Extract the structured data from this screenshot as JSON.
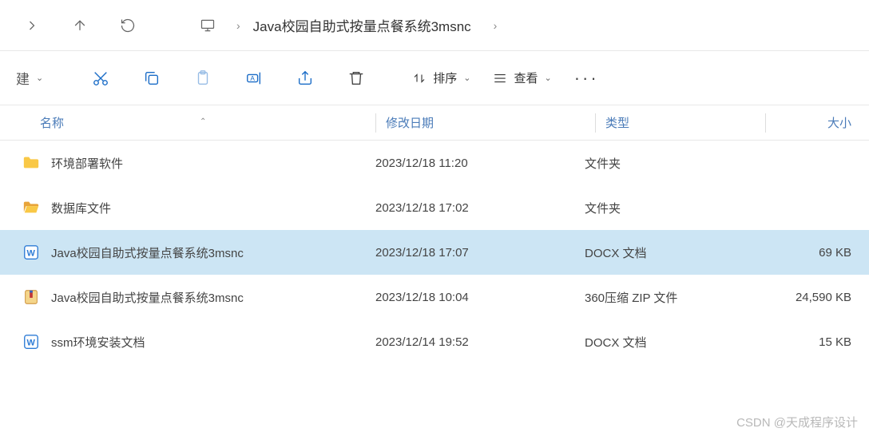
{
  "nav": {
    "breadcrumb_item": "Java校园自助式按量点餐系统3msnc"
  },
  "toolbar": {
    "new_label": "建",
    "sort_label": "排序",
    "view_label": "查看"
  },
  "headers": {
    "name": "名称",
    "date": "修改日期",
    "type": "类型",
    "size": "大小"
  },
  "files": [
    {
      "name": "环境部署软件",
      "date": "2023/12/18 11:20",
      "type": "文件夹",
      "size": "",
      "icon": "folder",
      "selected": false
    },
    {
      "name": "数据库文件",
      "date": "2023/12/18 17:02",
      "type": "文件夹",
      "size": "",
      "icon": "folder-open",
      "selected": false
    },
    {
      "name": "Java校园自助式按量点餐系统3msnc",
      "date": "2023/12/18 17:07",
      "type": "DOCX 文档",
      "size": "69 KB",
      "icon": "docx",
      "selected": true
    },
    {
      "name": "Java校园自助式按量点餐系统3msnc",
      "date": "2023/12/18 10:04",
      "type": "360压缩 ZIP 文件",
      "size": "24,590 KB",
      "icon": "zip",
      "selected": false
    },
    {
      "name": "ssm环境安装文档",
      "date": "2023/12/14 19:52",
      "type": "DOCX 文档",
      "size": "15 KB",
      "icon": "docx",
      "selected": false
    }
  ],
  "watermark": "CSDN @天成程序设计"
}
